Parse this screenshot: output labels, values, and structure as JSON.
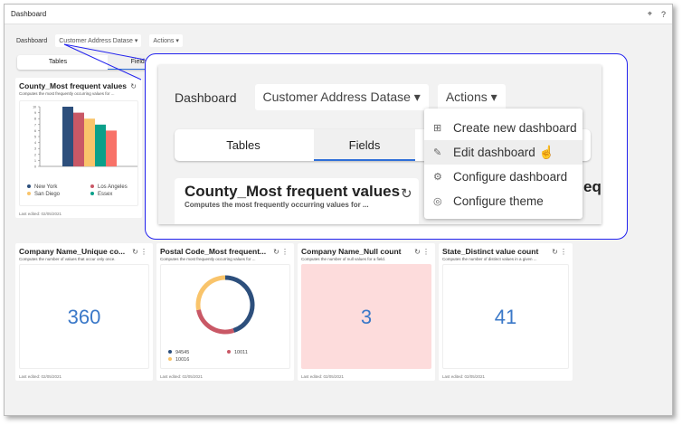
{
  "window": {
    "title": "Dashboard",
    "icons": [
      "crosshair-icon",
      "help-icon"
    ],
    "help": "?"
  },
  "toolbar": {
    "label": "Dashboard",
    "dataset": "Customer Address Datase",
    "actions": "Actions"
  },
  "tabs": [
    "Tables",
    "Fields"
  ],
  "cards": [
    {
      "title": "County_Most frequent values",
      "desc": "Computes the most frequently occurring values for ...",
      "footer": "Last edited: 02/05/2021"
    },
    {
      "title": "Company Name_Unique co...",
      "desc": "Computes the number of values that occur only once.",
      "value": "360",
      "footer": "Last edited: 02/05/2021"
    },
    {
      "title": "Postal Code_Most frequent...",
      "desc": "Computes the most frequently occurring values for ...",
      "footer": "Last edited: 02/05/2021"
    },
    {
      "title": "Company Name_Null count",
      "desc": "Computes the number of null values for a field.",
      "value": "3",
      "footer": "Last edited: 02/05/2021"
    },
    {
      "title": "State_Distinct value count",
      "desc": "Computes the number of distinct values in a given ...",
      "value": "41",
      "footer": "Last edited: 02/05/2021"
    }
  ],
  "chart_data": [
    {
      "type": "bar",
      "values": [
        10,
        9,
        8,
        7,
        6
      ],
      "colors": [
        "#2d4f7c",
        "#c95866",
        "#f9c46b",
        "#0aa08a",
        "#f87268"
      ],
      "legend": [
        "New York",
        "Los Angeles",
        "San Diego",
        "Essex"
      ],
      "ylim": [
        0,
        10
      ],
      "yticks": [
        "0",
        "1",
        "2",
        "3",
        "4",
        "5",
        "6",
        "7",
        "8",
        "9",
        "10"
      ]
    },
    {
      "type": "pie",
      "donut": true,
      "labels": [
        "94545",
        "10011",
        "10016"
      ],
      "values": [
        45,
        27,
        28
      ],
      "colors": [
        "#2d4f7c",
        "#c95866",
        "#f9c46b"
      ]
    }
  ],
  "callout": {
    "dashboard": "Dashboard",
    "dataset": "Customer Address Datase",
    "actions": "Actions",
    "tabs": [
      "Tables",
      "Fields"
    ],
    "card_title": "County_Most frequent values",
    "card_desc": "Computes the most frequently occurring values for ...",
    "partial_title": "equ",
    "menu": [
      {
        "label": "Create new dashboard",
        "icon": "plus-square-icon"
      },
      {
        "label": "Edit dashboard",
        "icon": "edit-icon"
      },
      {
        "label": "Configure dashboard",
        "icon": "gear-icon"
      },
      {
        "label": "Configure theme",
        "icon": "theme-icon"
      }
    ]
  },
  "colors": {
    "accent": "#3a78c8",
    "callout_border": "#2222ee",
    "null_bg": "#fddcdc"
  }
}
